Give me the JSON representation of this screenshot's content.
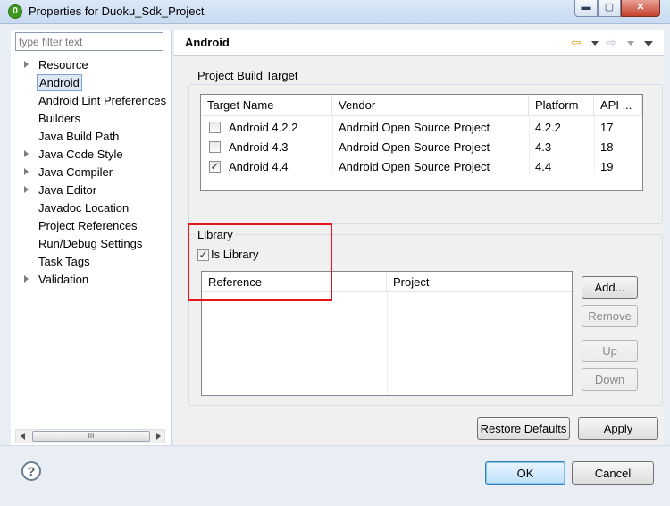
{
  "window": {
    "title": "Properties for Duoku_Sdk_Project",
    "icon_glyph": "0",
    "minimize_glyph": "▬",
    "maximize_glyph": "▢",
    "close_glyph": "✕"
  },
  "sidebar": {
    "filter_placeholder": "type filter text",
    "items": [
      {
        "label": "Resource",
        "expandable": true,
        "selected": false
      },
      {
        "label": "Android",
        "expandable": false,
        "selected": true
      },
      {
        "label": "Android Lint Preferences",
        "expandable": false,
        "selected": false
      },
      {
        "label": "Builders",
        "expandable": false,
        "selected": false
      },
      {
        "label": "Java Build Path",
        "expandable": false,
        "selected": false
      },
      {
        "label": "Java Code Style",
        "expandable": true,
        "selected": false
      },
      {
        "label": "Java Compiler",
        "expandable": true,
        "selected": false
      },
      {
        "label": "Java Editor",
        "expandable": true,
        "selected": false
      },
      {
        "label": "Javadoc Location",
        "expandable": false,
        "selected": false
      },
      {
        "label": "Project References",
        "expandable": false,
        "selected": false
      },
      {
        "label": "Run/Debug Settings",
        "expandable": false,
        "selected": false
      },
      {
        "label": "Task Tags",
        "expandable": false,
        "selected": false
      },
      {
        "label": "Validation",
        "expandable": true,
        "selected": false
      }
    ],
    "scroll_thumb_grip": "III"
  },
  "page": {
    "title": "Android",
    "nav_back_glyph": "⇦",
    "nav_forward_glyph": "⇨"
  },
  "build_target": {
    "group_label": "Project Build Target",
    "columns": [
      "Target Name",
      "Vendor",
      "Platform",
      "API ..."
    ],
    "rows": [
      {
        "name": "Android 4.2.2",
        "vendor": "Android Open Source Project",
        "platform": "4.2.2",
        "api": "17",
        "checked": false
      },
      {
        "name": "Android 4.3",
        "vendor": "Android Open Source Project",
        "platform": "4.3",
        "api": "18",
        "checked": false
      },
      {
        "name": "Android 4.4",
        "vendor": "Android Open Source Project",
        "platform": "4.4",
        "api": "19",
        "checked": true
      }
    ]
  },
  "library": {
    "group_label": "Library",
    "is_library_label": "Is Library",
    "is_library_checked": true,
    "columns": [
      "Reference",
      "Project"
    ],
    "add_label": "Add...",
    "remove_label": "Remove",
    "up_label": "Up",
    "down_label": "Down"
  },
  "page_buttons": {
    "restore_defaults": "Restore Defaults",
    "apply": "Apply"
  },
  "dialog_buttons": {
    "help_glyph": "?",
    "ok": "OK",
    "cancel": "Cancel"
  },
  "colors": {
    "highlight_annotation": "#e3161b",
    "selection_border": "#7da2ce",
    "ok_button_border": "#3c7fb1"
  }
}
